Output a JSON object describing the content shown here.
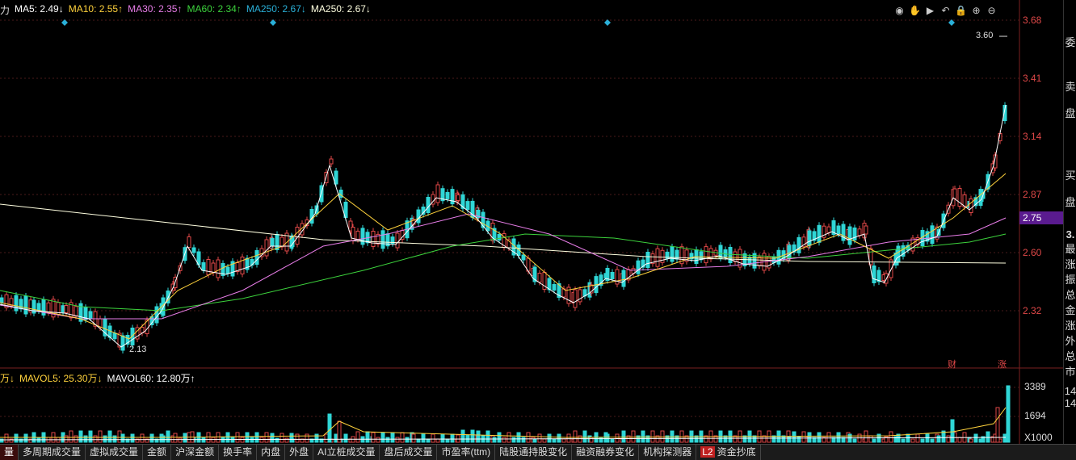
{
  "legend": {
    "prefix": "力",
    "items": [
      {
        "text": "MA5: 2.49↓",
        "color": "#ffffff"
      },
      {
        "text": "MA10: 2.55↑",
        "color": "#ffd23c"
      },
      {
        "text": "MA30: 2.35↑",
        "color": "#e87de8"
      },
      {
        "text": "MA60: 2.34↑",
        "color": "#3cd23c"
      },
      {
        "text": "MA250: 2.67↓",
        "color": "#2ab0d8"
      },
      {
        "text": "MA250: 2.67↓",
        "color": "#ffffe0"
      }
    ]
  },
  "vol_legend": {
    "prefix": "万↓",
    "items": [
      {
        "text": "MAVOL5: 25.30万↓",
        "color": "#ffd23c"
      },
      {
        "text": "MAVOL60: 12.80万↑",
        "color": "#ffffff"
      }
    ]
  },
  "price_axis": [
    "3.68",
    "3.41",
    "3.14",
    "2.87",
    "2.60",
    "2.32"
  ],
  "current_price_tag": "2.75",
  "high_label": "3.60",
  "low_label": "2.13",
  "volume_axis": [
    "3389",
    "1694",
    "X1000"
  ],
  "marks": {
    "cai": "财",
    "zhang": "涨"
  },
  "side_panel": [
    "委",
    "卖",
    "盘",
    "买",
    "盘",
    "3.",
    "最",
    "涨",
    "振",
    "总",
    "金",
    "涨",
    "外",
    "总",
    "市",
    "14",
    "14"
  ],
  "tabs": [
    {
      "label": "量",
      "active": true
    },
    {
      "label": "多周期成交量"
    },
    {
      "label": "虚拟成交量"
    },
    {
      "label": "金额"
    },
    {
      "label": "沪深金额"
    },
    {
      "label": "换手率"
    },
    {
      "label": "内盘"
    },
    {
      "label": "外盘"
    },
    {
      "label": "AI立桩成交量"
    },
    {
      "label": "盘后成交量"
    },
    {
      "label": "市盈率(ttm)"
    },
    {
      "label": "陆股通持股变化"
    },
    {
      "label": "融资融券变化"
    },
    {
      "label": "机构探测器"
    },
    {
      "label": "资金抄底",
      "badge": "L2"
    }
  ],
  "toolbar": [
    "eye-icon",
    "hand-icon",
    "play-icon",
    "undo-icon",
    "lock-icon",
    "zoom-in-icon",
    "zoom-out-icon"
  ],
  "chart_data": {
    "type": "candlestick",
    "price_range": [
      2.05,
      3.72
    ],
    "ma_values": {
      "MA5": 2.49,
      "MA10": 2.55,
      "MA30": 2.35,
      "MA60": 2.34,
      "MA250": 2.67
    },
    "volume_range": [
      0,
      3389
    ]
  }
}
